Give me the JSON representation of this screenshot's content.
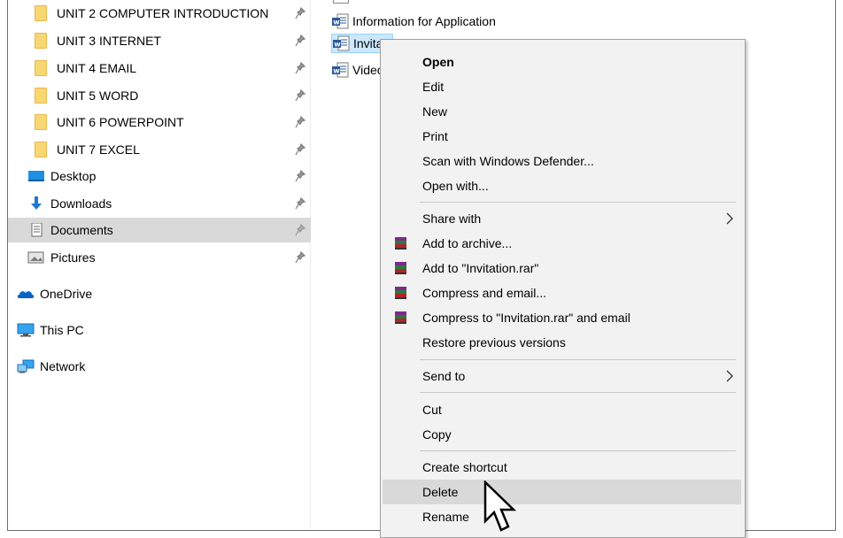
{
  "nav": {
    "pinned": [
      {
        "label": "UNIT 2 COMPUTER INTRODUCTION",
        "icon": "folder-icon"
      },
      {
        "label": "UNIT 3 INTERNET",
        "icon": "folder-icon"
      },
      {
        "label": "UNIT 4 EMAIL",
        "icon": "folder-icon"
      },
      {
        "label": "UNIT 5  WORD",
        "icon": "folder-icon"
      },
      {
        "label": "UNIT 6 POWERPOINT",
        "icon": "folder-icon"
      },
      {
        "label": "UNIT 7 EXCEL",
        "icon": "folder-icon"
      },
      {
        "label": "Desktop",
        "icon": "desktop-icon"
      },
      {
        "label": "Downloads",
        "icon": "download-icon"
      },
      {
        "label": "Documents",
        "icon": "documents-icon",
        "selected": true
      },
      {
        "label": "Pictures",
        "icon": "pictures-icon"
      }
    ],
    "roots": [
      {
        "label": "OneDrive",
        "icon": "onedrive-icon"
      },
      {
        "label": "This PC",
        "icon": "this-pc-icon"
      },
      {
        "label": "Network",
        "icon": "network-icon"
      }
    ]
  },
  "files": [
    {
      "label": "Information for Application",
      "icon": "word-doc-icon"
    },
    {
      "label": "Invitati",
      "icon": "word-doc-icon",
      "selected": true
    },
    {
      "label": "Video",
      "icon": "word-doc-icon"
    }
  ],
  "context_menu": {
    "items": {
      "open": "Open",
      "edit": "Edit",
      "new": "New",
      "print": "Print",
      "scan": "Scan with Windows Defender...",
      "open_with": "Open with...",
      "share_with": "Share with",
      "add_archive": "Add to archive...",
      "add_rar": "Add to \"Invitation.rar\"",
      "compress_email": "Compress and email...",
      "compress_rar_email": "Compress to \"Invitation.rar\" and email",
      "restore": "Restore previous versions",
      "send_to": "Send to",
      "cut": "Cut",
      "copy": "Copy",
      "create_shortcut": "Create shortcut",
      "delete": "Delete",
      "rename": "Rename"
    },
    "hovered": "Delete"
  },
  "colors": {
    "selection": "#cce8ff",
    "nav_selected": "#d9d9d9",
    "menu_bg": "#f2f2f2",
    "folder": "#f7d774",
    "word_blue": "#2b579a"
  }
}
